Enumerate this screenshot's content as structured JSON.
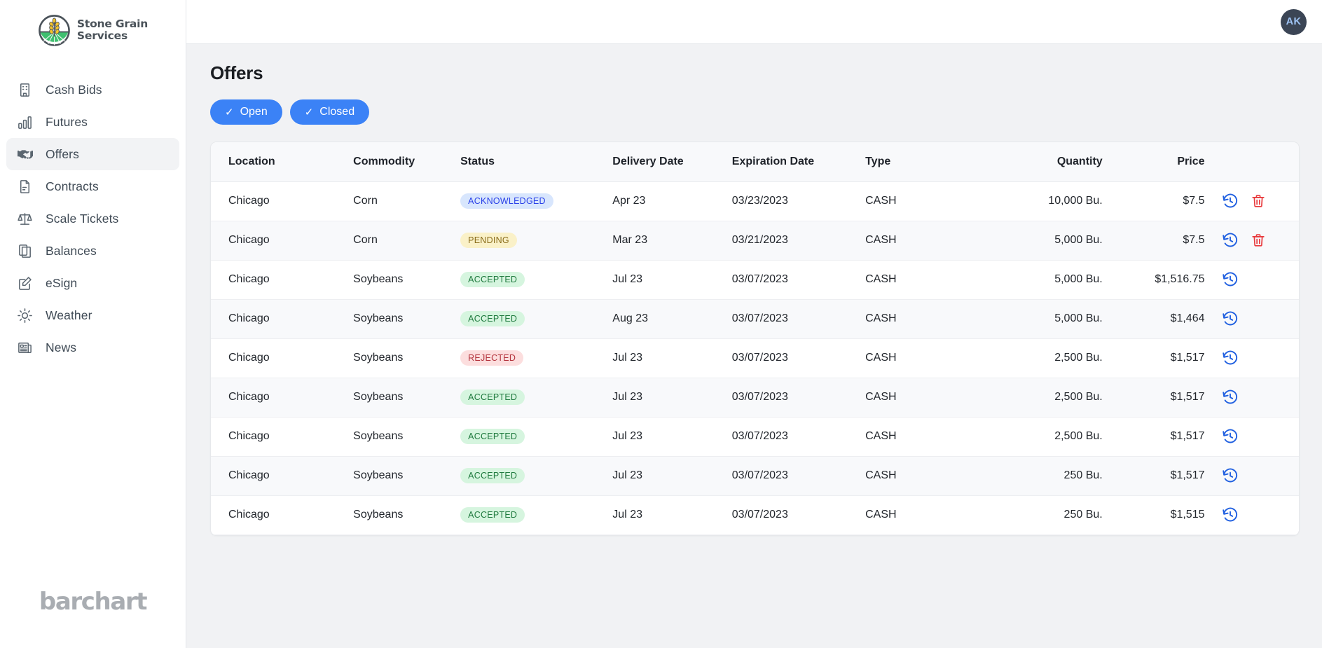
{
  "brand": {
    "line1": "Stone Grain",
    "line2": "Services",
    "logo_icon": "wheat-circle-logo",
    "field_color": "#3fbf6f",
    "wheat_color": "#f3c32c",
    "outline_color": "#3f4a55"
  },
  "sidebar": {
    "items": [
      {
        "label": "Cash Bids",
        "icon": "building-icon",
        "active": false
      },
      {
        "label": "Futures",
        "icon": "bar-chart-icon",
        "active": false
      },
      {
        "label": "Offers",
        "icon": "handshake-icon",
        "active": true
      },
      {
        "label": "Contracts",
        "icon": "document-icon",
        "active": false
      },
      {
        "label": "Scale Tickets",
        "icon": "scale-icon",
        "active": false
      },
      {
        "label": "Balances",
        "icon": "clipboard-icon",
        "active": false
      },
      {
        "label": "eSign",
        "icon": "pencil-square-icon",
        "active": false
      },
      {
        "label": "Weather",
        "icon": "sun-icon",
        "active": false
      },
      {
        "label": "News",
        "icon": "newspaper-icon",
        "active": false
      }
    ],
    "footer_logo": "barchart"
  },
  "topbar": {
    "avatar_initials": "AK",
    "avatar_bg": "#3b4555",
    "avatar_fg": "#9fc4f5"
  },
  "page": {
    "title": "Offers"
  },
  "filters": {
    "accent_color": "#3b82f6",
    "check_glyph": "✓",
    "chips": [
      {
        "label": "Open",
        "selected": true
      },
      {
        "label": "Closed",
        "selected": true
      }
    ]
  },
  "table": {
    "columns": [
      "Location",
      "Commodity",
      "Status",
      "Delivery Date",
      "Expiration Date",
      "Type",
      "Quantity",
      "Price"
    ],
    "actions": {
      "history_icon": "history-clock-icon",
      "history_color": "#1f5fe0",
      "delete_icon": "trash-icon",
      "delete_color": "#e8393c"
    },
    "rows": [
      {
        "location": "Chicago",
        "commodity": "Corn",
        "status": "ACKNOWLEDGED",
        "status_kind": "acknowledged",
        "delivery_date": "Apr 23",
        "expiration_date": "03/23/2023",
        "type": "CASH",
        "quantity": "10,000 Bu.",
        "price": "$7.5",
        "has_history": true,
        "has_delete": true
      },
      {
        "location": "Chicago",
        "commodity": "Corn",
        "status": "PENDING",
        "status_kind": "pending",
        "delivery_date": "Mar 23",
        "expiration_date": "03/21/2023",
        "type": "CASH",
        "quantity": "5,000 Bu.",
        "price": "$7.5",
        "has_history": true,
        "has_delete": true
      },
      {
        "location": "Chicago",
        "commodity": "Soybeans",
        "status": "ACCEPTED",
        "status_kind": "accepted",
        "delivery_date": "Jul 23",
        "expiration_date": "03/07/2023",
        "type": "CASH",
        "quantity": "5,000 Bu.",
        "price": "$1,516.75",
        "has_history": true,
        "has_delete": false
      },
      {
        "location": "Chicago",
        "commodity": "Soybeans",
        "status": "ACCEPTED",
        "status_kind": "accepted",
        "delivery_date": "Aug 23",
        "expiration_date": "03/07/2023",
        "type": "CASH",
        "quantity": "5,000 Bu.",
        "price": "$1,464",
        "has_history": true,
        "has_delete": false
      },
      {
        "location": "Chicago",
        "commodity": "Soybeans",
        "status": "REJECTED",
        "status_kind": "rejected",
        "delivery_date": "Jul 23",
        "expiration_date": "03/07/2023",
        "type": "CASH",
        "quantity": "2,500 Bu.",
        "price": "$1,517",
        "has_history": true,
        "has_delete": false
      },
      {
        "location": "Chicago",
        "commodity": "Soybeans",
        "status": "ACCEPTED",
        "status_kind": "accepted",
        "delivery_date": "Jul 23",
        "expiration_date": "03/07/2023",
        "type": "CASH",
        "quantity": "2,500 Bu.",
        "price": "$1,517",
        "has_history": true,
        "has_delete": false
      },
      {
        "location": "Chicago",
        "commodity": "Soybeans",
        "status": "ACCEPTED",
        "status_kind": "accepted",
        "delivery_date": "Jul 23",
        "expiration_date": "03/07/2023",
        "type": "CASH",
        "quantity": "2,500 Bu.",
        "price": "$1,517",
        "has_history": true,
        "has_delete": false
      },
      {
        "location": "Chicago",
        "commodity": "Soybeans",
        "status": "ACCEPTED",
        "status_kind": "accepted",
        "delivery_date": "Jul 23",
        "expiration_date": "03/07/2023",
        "type": "CASH",
        "quantity": "250 Bu.",
        "price": "$1,517",
        "has_history": true,
        "has_delete": false
      },
      {
        "location": "Chicago",
        "commodity": "Soybeans",
        "status": "ACCEPTED",
        "status_kind": "accepted",
        "delivery_date": "Jul 23",
        "expiration_date": "03/07/2023",
        "type": "CASH",
        "quantity": "250 Bu.",
        "price": "$1,515",
        "has_history": true,
        "has_delete": false
      }
    ]
  }
}
